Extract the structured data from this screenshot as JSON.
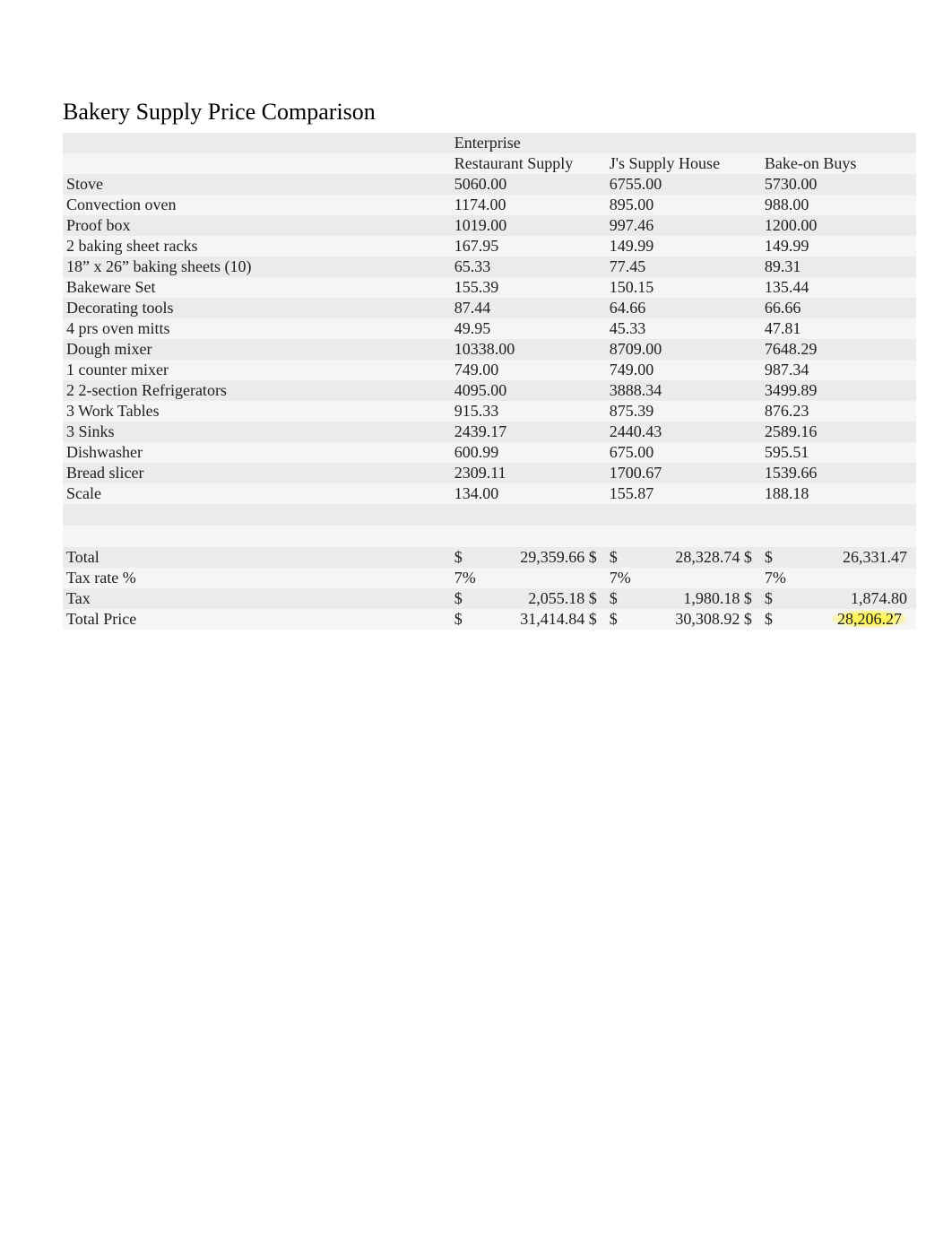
{
  "title": "Bakery Supply Price Comparison",
  "columns": [
    "Enterprise Restaurant Supply",
    "J's Supply House",
    "Bake-on Buys"
  ],
  "items": [
    {
      "label": "Stove",
      "v": [
        "5060.00",
        "6755.00",
        "5730.00"
      ]
    },
    {
      "label": "Convection oven",
      "v": [
        "1174.00",
        "895.00",
        "988.00"
      ]
    },
    {
      "label": "Proof box",
      "v": [
        "1019.00",
        "997.46",
        "1200.00"
      ]
    },
    {
      "label": "2 baking sheet racks",
      "v": [
        "167.95",
        "149.99",
        "149.99"
      ]
    },
    {
      "label": "18” x 26” baking sheets (10)",
      "v": [
        "65.33",
        "77.45",
        "89.31"
      ]
    },
    {
      "label": "Bakeware Set",
      "v": [
        "155.39",
        "150.15",
        "135.44"
      ]
    },
    {
      "label": "Decorating tools",
      "v": [
        "87.44",
        "64.66",
        "66.66"
      ]
    },
    {
      "label": "4 prs oven mitts",
      "v": [
        "49.95",
        "45.33",
        "47.81"
      ]
    },
    {
      "label": "Dough mixer",
      "v": [
        "10338.00",
        "8709.00",
        "7648.29"
      ]
    },
    {
      "label": "1 counter mixer",
      "v": [
        "749.00",
        "749.00",
        "987.34"
      ]
    },
    {
      "label": "2 2-section Refrigerators",
      "v": [
        "4095.00",
        "3888.34",
        "3499.89"
      ]
    },
    {
      "label": "3 Work Tables",
      "v": [
        "915.33",
        "875.39",
        "876.23"
      ]
    },
    {
      "label": "3 Sinks",
      "v": [
        "2439.17",
        "2440.43",
        "2589.16"
      ]
    },
    {
      "label": "Dishwasher",
      "v": [
        "600.99",
        "675.00",
        "595.51"
      ]
    },
    {
      "label": "Bread slicer",
      "v": [
        "2309.11",
        "1700.67",
        "1539.66"
      ]
    },
    {
      "label": "Scale",
      "v": [
        "134.00",
        "155.87",
        "188.18"
      ]
    }
  ],
  "summary": {
    "total": {
      "label": "Total",
      "v": [
        "29,359.66",
        "28,328.74",
        "26,331.47"
      ]
    },
    "tax_rate": {
      "label": "Tax rate %",
      "v": [
        "7%",
        "7%",
        "7%"
      ]
    },
    "tax": {
      "label": "Tax",
      "v": [
        "2,055.18",
        "1,980.18",
        "1,874.80"
      ]
    },
    "total_price": {
      "label": "Total Price",
      "v": [
        "31,414.84",
        "30,308.92",
        "28,206.27"
      ]
    }
  },
  "currency_symbol": "$"
}
